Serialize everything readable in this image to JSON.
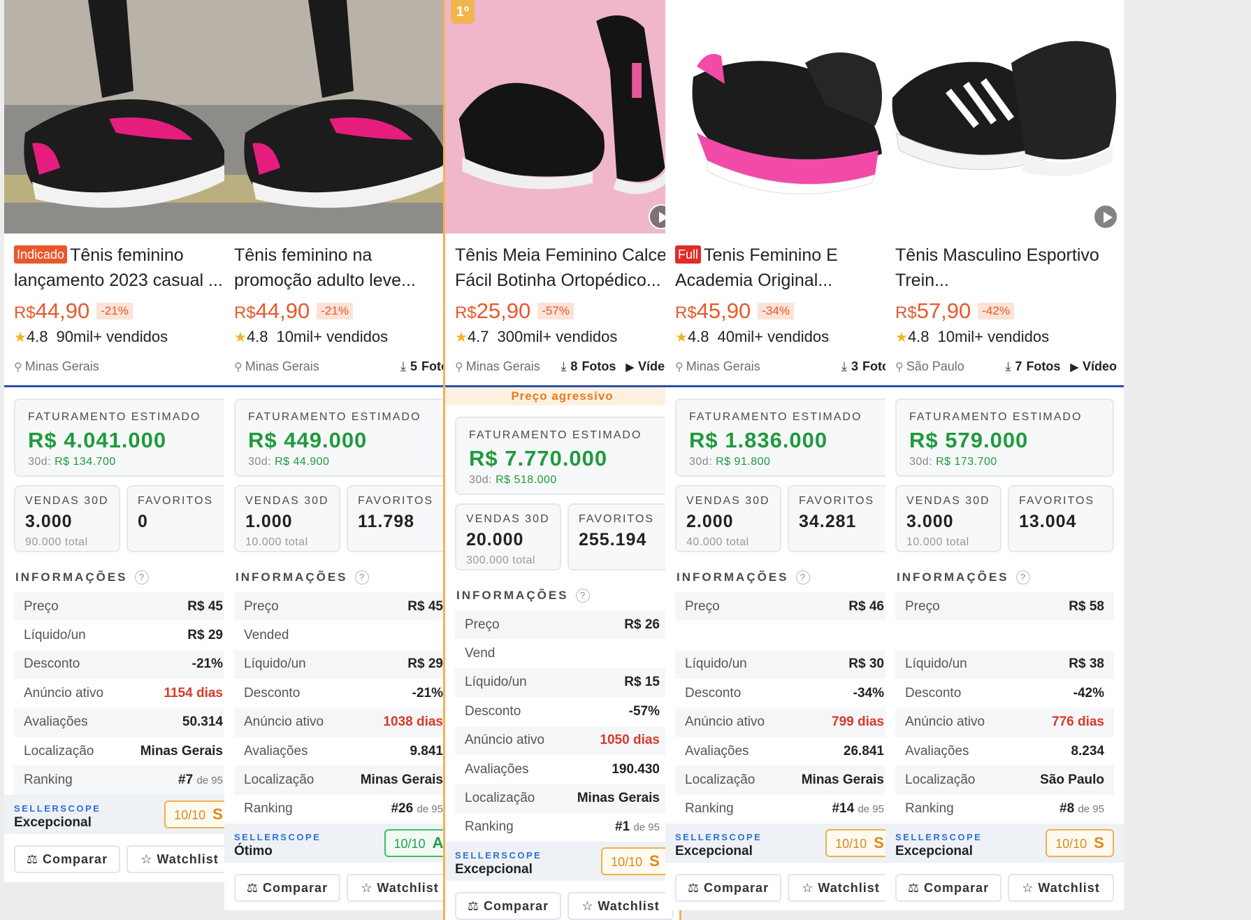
{
  "ui": {
    "labels": {
      "fat": "FATURAMENTO ESTIMADO",
      "d30": "30d:",
      "vendas": "VENDAS 30D",
      "fav": "FAVORITOS",
      "info": "INFORMAÇÕES",
      "ss": "SELLERSCOPE",
      "comparar": "Comparar",
      "watchlist": "Watchlist",
      "preco_agressivo": "Preço agressivo",
      "fotos_suffix": "Fotos",
      "video": "Vídeo",
      "help": "?",
      "de": "de 95"
    },
    "icons": {
      "star": "★",
      "pin": "⚲",
      "download": "⤓",
      "play": "▶",
      "compare": "⚖",
      "watch": "☆"
    }
  },
  "products": [
    {
      "id": "p1",
      "image_theme": "pink-sneaker-worn",
      "tag": "Indicado",
      "title_lines": [
        "Tênis feminino",
        "lançamento 2023 casual ..."
      ],
      "price_currency": "R$",
      "price_value": "44,90",
      "discount": "-21%",
      "rating": "4.8",
      "sold": "90mil+ vendidos",
      "location": "Minas Gerais",
      "fat_total": "R$ 4.041.000",
      "fat_30d": "R$ 134.700",
      "vendas_30d": "3.000",
      "vendas_total": "90.000 total",
      "favoritos": "0",
      "info": [
        {
          "label": "Preço",
          "value": "R$ 45"
        },
        {
          "label": "Líquido/un",
          "value": "R$ 29"
        },
        {
          "label": "Desconto",
          "value": "-21%"
        },
        {
          "label": "Anúncio ativo",
          "value": "1154 dias"
        },
        {
          "label": "Avaliações",
          "value": "50.314"
        },
        {
          "label": "Localização",
          "value": "Minas Gerais"
        },
        {
          "label": "Ranking",
          "value": "#7"
        }
      ],
      "ss_text": "Excepcional",
      "score": "10/10",
      "score_letter": "S"
    },
    {
      "id": "p2",
      "image_theme": "pink-sneaker-worn",
      "title_lines": [
        "Tênis feminino na",
        "promoção adulto leve..."
      ],
      "price_currency": "R$",
      "price_value": "44,90",
      "discount": "-21%",
      "rating": "4.8",
      "sold": "10mil+ vendidos",
      "location": "Minas Gerais",
      "fotos": "5",
      "fat_total": "R$ 449.000",
      "fat_30d": "R$ 44.900",
      "vendas_30d": "1.000",
      "vendas_total": "10.000 total",
      "favoritos": "11.798",
      "info": [
        {
          "label": "Preço",
          "value": "R$ 45"
        },
        {
          "label": "Vended",
          "value": ""
        },
        {
          "label": "Líquido/un",
          "value": "R$ 29"
        },
        {
          "label": "Desconto",
          "value": "-21%"
        },
        {
          "label": "Anúncio ativo",
          "value": "1038 dias"
        },
        {
          "label": "Avaliações",
          "value": "9.841"
        },
        {
          "label": "Localização",
          "value": "Minas Gerais"
        },
        {
          "label": "Ranking",
          "value": "#26"
        }
      ],
      "ss_text": "Ótimo",
      "score": "10/10",
      "score_letter": "A"
    },
    {
      "id": "p3",
      "image_theme": "black-slipon-pink",
      "rank_badge": "1º",
      "title_lines": [
        "Tênis Meia Feminino Calce",
        "Fácil Botinha Ortopédico..."
      ],
      "price_currency": "R$",
      "price_value": "25,90",
      "discount": "-57%",
      "rating": "4.7",
      "sold": "300mil+ vendidos",
      "location": "Minas Gerais",
      "fotos": "8",
      "video": true,
      "fat_total": "R$ 7.770.000",
      "fat_30d": "R$ 518.000",
      "vendas_30d": "20.000",
      "vendas_total": "300.000 total",
      "favoritos": "255.194",
      "info": [
        {
          "label": "Preço",
          "value": "R$ 26"
        },
        {
          "label": "Vend",
          "value": ""
        },
        {
          "label": "Líquido/un",
          "value": "R$ 15"
        },
        {
          "label": "Desconto",
          "value": "-57%"
        },
        {
          "label": "Anúncio ativo",
          "value": "1050 dias"
        },
        {
          "label": "Avaliações",
          "value": "190.430"
        },
        {
          "label": "Localização",
          "value": "Minas Gerais"
        },
        {
          "label": "Ranking",
          "value": "#1"
        }
      ],
      "ss_text": "Excepcional",
      "score": "10/10",
      "score_letter": "S"
    },
    {
      "id": "p4",
      "image_theme": "black-pink-runner",
      "tag": "Full",
      "title_lines": [
        "Tenis Feminino E",
        "Academia Original..."
      ],
      "price_currency": "R$",
      "price_value": "45,90",
      "discount": "-34%",
      "rating": "4.8",
      "sold": "40mil+ vendidos",
      "location": "Minas Gerais",
      "fotos": "3",
      "fat_total": "R$ 1.836.000",
      "fat_30d": "R$ 91.800",
      "vendas_30d": "2.000",
      "vendas_total": "40.000 total",
      "favoritos": "34.281",
      "info": [
        {
          "label": "Preço",
          "value": "R$ 46"
        },
        {
          "label": "",
          "value": ""
        },
        {
          "label": "Líquido/un",
          "value": "R$ 30"
        },
        {
          "label": "Desconto",
          "value": "-34%"
        },
        {
          "label": "Anúncio ativo",
          "value": "799 dias"
        },
        {
          "label": "Avaliações",
          "value": "26.841"
        },
        {
          "label": "Localização",
          "value": "Minas Gerais"
        },
        {
          "label": "Ranking",
          "value": "#14"
        }
      ],
      "ss_text": "Excepcional",
      "score": "10/10",
      "score_letter": "S"
    },
    {
      "id": "p5",
      "image_theme": "black-white-stripes",
      "title_lines": [
        "Tênis Masculino Esportivo",
        "Trein..."
      ],
      "price_currency": "R$",
      "price_value": "57,90",
      "discount": "-42%",
      "rating": "4.8",
      "sold": "10mil+ vendidos",
      "location": "São Paulo",
      "fotos": "7",
      "video": true,
      "fat_total": "R$ 579.000",
      "fat_30d": "R$ 173.700",
      "vendas_30d": "3.000",
      "vendas_total": "10.000 total",
      "favoritos": "13.004",
      "info": [
        {
          "label": "Preço",
          "value": "R$ 58"
        },
        {
          "label": "",
          "value": ""
        },
        {
          "label": "Líquido/un",
          "value": "R$ 38"
        },
        {
          "label": "Desconto",
          "value": "-42%"
        },
        {
          "label": "Anúncio ativo",
          "value": "776 dias"
        },
        {
          "label": "Avaliações",
          "value": "8.234"
        },
        {
          "label": "Localização",
          "value": "São Paulo"
        },
        {
          "label": "Ranking",
          "value": "#8"
        }
      ],
      "ss_text": "Excepcional",
      "score": "10/10",
      "score_letter": "S"
    }
  ],
  "colors": {
    "accent_price": "#e8582c",
    "revenue_green": "#1f9a3c",
    "top_border": "#f2b34d",
    "separator_blue": "#2c4fa8",
    "sellerscope_blue": "#2c6fd6",
    "active_days_red": "#d63a2a"
  }
}
